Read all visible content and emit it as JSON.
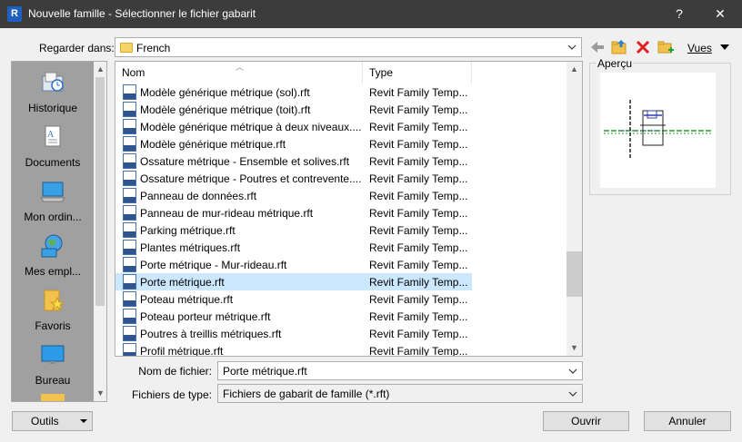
{
  "window": {
    "app_icon_letter": "R",
    "title": "Nouvelle famille - Sélectionner le fichier gabarit",
    "help_glyph": "?",
    "close_glyph": "✕"
  },
  "lookin": {
    "label": "Regarder dans:",
    "value": "French"
  },
  "toolbar": {
    "views_label": "Vues"
  },
  "places": [
    {
      "label": "Historique",
      "icon": "history-icon"
    },
    {
      "label": "Documents",
      "icon": "documents-icon"
    },
    {
      "label": "Mon ordin...",
      "icon": "computer-icon"
    },
    {
      "label": "Mes empl...",
      "icon": "network-icon"
    },
    {
      "label": "Favoris",
      "icon": "favorites-icon"
    },
    {
      "label": "Bureau",
      "icon": "desktop-icon"
    }
  ],
  "filelist": {
    "columns": [
      "Nom",
      "Type"
    ],
    "rows": [
      {
        "name": "Modèle générique métrique (sol).rft",
        "type": "Revit Family Temp..."
      },
      {
        "name": "Modèle générique métrique (toit).rft",
        "type": "Revit Family Temp..."
      },
      {
        "name": "Modèle générique métrique à deux niveaux....",
        "type": "Revit Family Temp..."
      },
      {
        "name": "Modèle générique métrique.rft",
        "type": "Revit Family Temp..."
      },
      {
        "name": "Ossature métrique - Ensemble et solives.rft",
        "type": "Revit Family Temp..."
      },
      {
        "name": "Ossature métrique - Poutres et contrevente....",
        "type": "Revit Family Temp..."
      },
      {
        "name": "Panneau de données.rft",
        "type": "Revit Family Temp..."
      },
      {
        "name": "Panneau de mur-rideau métrique.rft",
        "type": "Revit Family Temp..."
      },
      {
        "name": "Parking métrique.rft",
        "type": "Revit Family Temp..."
      },
      {
        "name": "Plantes métriques.rft",
        "type": "Revit Family Temp..."
      },
      {
        "name": "Porte métrique - Mur-rideau.rft",
        "type": "Revit Family Temp..."
      },
      {
        "name": "Porte métrique.rft",
        "type": "Revit Family Temp...",
        "selected": true
      },
      {
        "name": "Poteau métrique.rft",
        "type": "Revit Family Temp..."
      },
      {
        "name": "Poteau porteur métrique.rft",
        "type": "Revit Family Temp..."
      },
      {
        "name": "Poutres à treillis métriques.rft",
        "type": "Revit Family Temp..."
      },
      {
        "name": "Profil métrique.rft",
        "type": "Revit Family Temp..."
      }
    ]
  },
  "preview": {
    "label": "Aperçu"
  },
  "filename": {
    "label": "Nom de fichier:",
    "value": "Porte métrique.rft"
  },
  "filetype": {
    "label": "Fichiers de type:",
    "value": "Fichiers de gabarit de famille  (*.rft)"
  },
  "buttons": {
    "tools": "Outils",
    "open": "Ouvrir",
    "cancel": "Annuler"
  },
  "colors": {
    "titlebar": "#3c3c3c",
    "selection": "#cce8ff",
    "places_bg": "#a0a0a0"
  }
}
